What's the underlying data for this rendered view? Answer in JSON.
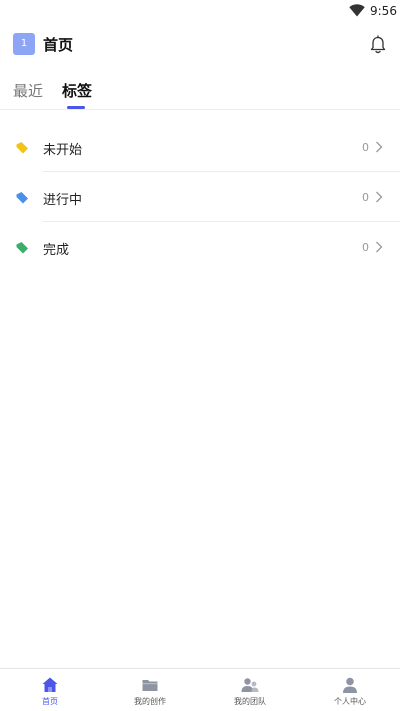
{
  "status_bar": {
    "time": "9:56",
    "wifi_icon": "wifi-icon"
  },
  "header": {
    "badge": "1",
    "title": "首页",
    "bell_icon": "bell-icon"
  },
  "tabs": [
    {
      "label": "最近",
      "active": false
    },
    {
      "label": "标签",
      "active": true
    }
  ],
  "tag_list": [
    {
      "label": "未开始",
      "count": "0",
      "color": "#f2c21a"
    },
    {
      "label": "进行中",
      "count": "0",
      "color": "#4a8fe8"
    },
    {
      "label": "完成",
      "count": "0",
      "color": "#3aae6a"
    }
  ],
  "bottom_nav": [
    {
      "label": "首页",
      "icon": "home-icon",
      "active": true
    },
    {
      "label": "我的创作",
      "icon": "folder-icon",
      "active": false
    },
    {
      "label": "我的团队",
      "icon": "team-icon",
      "active": false
    },
    {
      "label": "个人中心",
      "icon": "person-icon",
      "active": false
    }
  ],
  "colors": {
    "accent": "#4b55e8",
    "badge": "#8da5f5",
    "inactive_icon": "#8f94a3"
  }
}
